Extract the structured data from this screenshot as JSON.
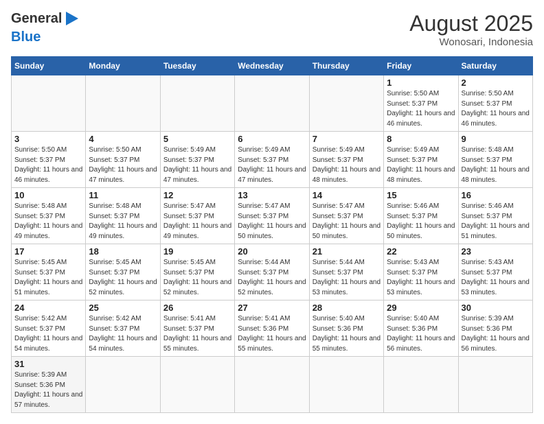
{
  "header": {
    "logo_general": "General",
    "logo_blue": "Blue",
    "month_title": "August 2025",
    "location": "Wonosari, Indonesia"
  },
  "days_of_week": [
    "Sunday",
    "Monday",
    "Tuesday",
    "Wednesday",
    "Thursday",
    "Friday",
    "Saturday"
  ],
  "weeks": [
    [
      {
        "day": "",
        "info": ""
      },
      {
        "day": "",
        "info": ""
      },
      {
        "day": "",
        "info": ""
      },
      {
        "day": "",
        "info": ""
      },
      {
        "day": "",
        "info": ""
      },
      {
        "day": "1",
        "info": "Sunrise: 5:50 AM\nSunset: 5:37 PM\nDaylight: 11 hours\nand 46 minutes."
      },
      {
        "day": "2",
        "info": "Sunrise: 5:50 AM\nSunset: 5:37 PM\nDaylight: 11 hours\nand 46 minutes."
      }
    ],
    [
      {
        "day": "3",
        "info": "Sunrise: 5:50 AM\nSunset: 5:37 PM\nDaylight: 11 hours\nand 46 minutes."
      },
      {
        "day": "4",
        "info": "Sunrise: 5:50 AM\nSunset: 5:37 PM\nDaylight: 11 hours\nand 47 minutes."
      },
      {
        "day": "5",
        "info": "Sunrise: 5:49 AM\nSunset: 5:37 PM\nDaylight: 11 hours\nand 47 minutes."
      },
      {
        "day": "6",
        "info": "Sunrise: 5:49 AM\nSunset: 5:37 PM\nDaylight: 11 hours\nand 47 minutes."
      },
      {
        "day": "7",
        "info": "Sunrise: 5:49 AM\nSunset: 5:37 PM\nDaylight: 11 hours\nand 48 minutes."
      },
      {
        "day": "8",
        "info": "Sunrise: 5:49 AM\nSunset: 5:37 PM\nDaylight: 11 hours\nand 48 minutes."
      },
      {
        "day": "9",
        "info": "Sunrise: 5:48 AM\nSunset: 5:37 PM\nDaylight: 11 hours\nand 48 minutes."
      }
    ],
    [
      {
        "day": "10",
        "info": "Sunrise: 5:48 AM\nSunset: 5:37 PM\nDaylight: 11 hours\nand 49 minutes."
      },
      {
        "day": "11",
        "info": "Sunrise: 5:48 AM\nSunset: 5:37 PM\nDaylight: 11 hours\nand 49 minutes."
      },
      {
        "day": "12",
        "info": "Sunrise: 5:47 AM\nSunset: 5:37 PM\nDaylight: 11 hours\nand 49 minutes."
      },
      {
        "day": "13",
        "info": "Sunrise: 5:47 AM\nSunset: 5:37 PM\nDaylight: 11 hours\nand 50 minutes."
      },
      {
        "day": "14",
        "info": "Sunrise: 5:47 AM\nSunset: 5:37 PM\nDaylight: 11 hours\nand 50 minutes."
      },
      {
        "day": "15",
        "info": "Sunrise: 5:46 AM\nSunset: 5:37 PM\nDaylight: 11 hours\nand 50 minutes."
      },
      {
        "day": "16",
        "info": "Sunrise: 5:46 AM\nSunset: 5:37 PM\nDaylight: 11 hours\nand 51 minutes."
      }
    ],
    [
      {
        "day": "17",
        "info": "Sunrise: 5:45 AM\nSunset: 5:37 PM\nDaylight: 11 hours\nand 51 minutes."
      },
      {
        "day": "18",
        "info": "Sunrise: 5:45 AM\nSunset: 5:37 PM\nDaylight: 11 hours\nand 52 minutes."
      },
      {
        "day": "19",
        "info": "Sunrise: 5:45 AM\nSunset: 5:37 PM\nDaylight: 11 hours\nand 52 minutes."
      },
      {
        "day": "20",
        "info": "Sunrise: 5:44 AM\nSunset: 5:37 PM\nDaylight: 11 hours\nand 52 minutes."
      },
      {
        "day": "21",
        "info": "Sunrise: 5:44 AM\nSunset: 5:37 PM\nDaylight: 11 hours\nand 53 minutes."
      },
      {
        "day": "22",
        "info": "Sunrise: 5:43 AM\nSunset: 5:37 PM\nDaylight: 11 hours\nand 53 minutes."
      },
      {
        "day": "23",
        "info": "Sunrise: 5:43 AM\nSunset: 5:37 PM\nDaylight: 11 hours\nand 53 minutes."
      }
    ],
    [
      {
        "day": "24",
        "info": "Sunrise: 5:42 AM\nSunset: 5:37 PM\nDaylight: 11 hours\nand 54 minutes."
      },
      {
        "day": "25",
        "info": "Sunrise: 5:42 AM\nSunset: 5:37 PM\nDaylight: 11 hours\nand 54 minutes."
      },
      {
        "day": "26",
        "info": "Sunrise: 5:41 AM\nSunset: 5:37 PM\nDaylight: 11 hours\nand 55 minutes."
      },
      {
        "day": "27",
        "info": "Sunrise: 5:41 AM\nSunset: 5:36 PM\nDaylight: 11 hours\nand 55 minutes."
      },
      {
        "day": "28",
        "info": "Sunrise: 5:40 AM\nSunset: 5:36 PM\nDaylight: 11 hours\nand 55 minutes."
      },
      {
        "day": "29",
        "info": "Sunrise: 5:40 AM\nSunset: 5:36 PM\nDaylight: 11 hours\nand 56 minutes."
      },
      {
        "day": "30",
        "info": "Sunrise: 5:39 AM\nSunset: 5:36 PM\nDaylight: 11 hours\nand 56 minutes."
      }
    ],
    [
      {
        "day": "31",
        "info": "Sunrise: 5:39 AM\nSunset: 5:36 PM\nDaylight: 11 hours\nand 57 minutes."
      },
      {
        "day": "",
        "info": ""
      },
      {
        "day": "",
        "info": ""
      },
      {
        "day": "",
        "info": ""
      },
      {
        "day": "",
        "info": ""
      },
      {
        "day": "",
        "info": ""
      },
      {
        "day": "",
        "info": ""
      }
    ]
  ]
}
